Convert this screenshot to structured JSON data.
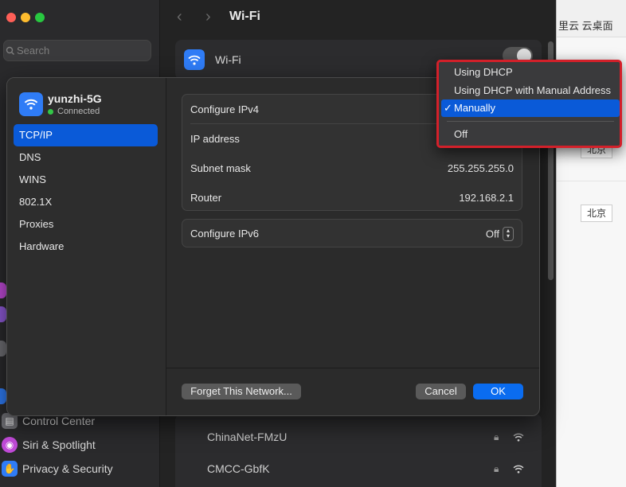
{
  "background": {
    "search_placeholder": "Search",
    "page_title": "Wi-Fi",
    "wifi_label": "Wi-Fi",
    "sidebar_items": [
      {
        "label": "Control Center",
        "color": "#6e6e73"
      },
      {
        "label": "Siri & Spotlight",
        "color": "#c04ad8"
      },
      {
        "label": "Privacy & Security",
        "color": "#2f7cf6"
      }
    ],
    "networks": [
      {
        "name": "ChinaNet-FMzU"
      },
      {
        "name": "CMCC-GbfK"
      }
    ]
  },
  "right_strip": {
    "header_text": "里云 云桌面",
    "tags": [
      "北京",
      "北京"
    ]
  },
  "sheet": {
    "network_name": "yunzhi-5G",
    "network_status": "Connected",
    "sidebar": [
      {
        "label": "TCP/IP"
      },
      {
        "label": "DNS"
      },
      {
        "label": "WINS"
      },
      {
        "label": "802.1X"
      },
      {
        "label": "Proxies"
      },
      {
        "label": "Hardware"
      }
    ],
    "ipv4": {
      "configure_label": "Configure IPv4",
      "ip_label": "IP address",
      "subnet_label": "Subnet mask",
      "subnet_value": "255.255.255.0",
      "router_label": "Router",
      "router_value": "192.168.2.1"
    },
    "ipv6": {
      "configure_label": "Configure IPv6",
      "configure_value": "Off"
    },
    "buttons": {
      "forget": "Forget This Network...",
      "cancel": "Cancel",
      "ok": "OK"
    }
  },
  "menu": {
    "items": [
      {
        "label": "Using DHCP",
        "selected": false
      },
      {
        "label": "Using DHCP with Manual Address",
        "selected": false
      },
      {
        "label": "Manually",
        "selected": true
      },
      {
        "label": "Off",
        "selected": false
      }
    ],
    "check_glyph": "✓",
    "highlight_color": "#d3202a"
  }
}
